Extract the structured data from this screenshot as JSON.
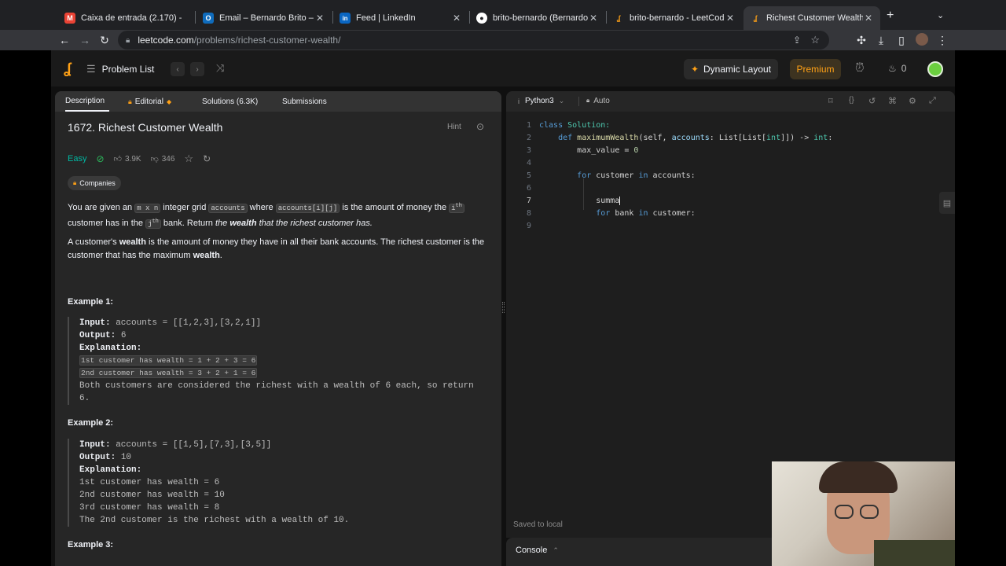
{
  "browser": {
    "tabs": [
      {
        "title": "Caixa de entrada (2.170) - ",
        "icon": "gmail-icon",
        "color": "#ea4335",
        "glyph": "M"
      },
      {
        "title": "Email – Bernardo Brito – Ou",
        "icon": "outlook-icon",
        "color": "#0f6cbd",
        "glyph": "O"
      },
      {
        "title": "Feed | LinkedIn",
        "icon": "linkedin-icon",
        "color": "#0a66c2",
        "glyph": "in"
      },
      {
        "title": "brito-bernardo (Bernardo B",
        "icon": "github-icon",
        "color": "#ffffff",
        "glyph": "●"
      },
      {
        "title": "brito-bernardo - LeetCode",
        "icon": "leetcode-icon",
        "color": "#ffa116",
        "glyph": "L"
      },
      {
        "title": "Richest Customer Wealth -",
        "icon": "leetcode-icon",
        "color": "#ffa116",
        "glyph": "L"
      }
    ],
    "url_host": "leetcode.com",
    "url_path": "/problems/richest-customer-wealth/"
  },
  "header": {
    "problem_list": "Problem List",
    "dynamic_layout": "Dynamic Layout",
    "premium": "Premium",
    "streak": "0"
  },
  "left_tabs": {
    "description": "Description",
    "editorial": "Editorial",
    "solutions": "Solutions (6.3K)",
    "submissions": "Submissions"
  },
  "problem": {
    "title": "1672. Richest Customer Wealth",
    "hint": "Hint",
    "difficulty": "Easy",
    "likes": "3.9K",
    "dislikes": "346",
    "companies": "Companies",
    "p1_a": "You are given an ",
    "p1_code1": "m x n",
    "p1_b": " integer grid ",
    "p1_code2": "accounts",
    "p1_c": " where ",
    "p1_code3": "accounts[i][j]",
    "p1_d": " is the amount of money the ",
    "p1_i": "i",
    "p1_th": "th",
    "p1_e": "customer has in the ",
    "p1_j": "j",
    "p1_f": " bank. Return ",
    "p1_g": "the ",
    "p1_h": "wealth",
    "p1_k": " that the richest customer has.",
    "p2_a": "A customer's ",
    "p2_b": "wealth",
    "p2_c": " is the amount of money they have in all their bank accounts. The richest customer is the customer that has the maximum ",
    "p2_d": "wealth",
    "p2_e": "."
  },
  "examples": {
    "ex1_title": "Example 1:",
    "ex1_input_label": "Input:",
    "ex1_input": " accounts = [[1,2,3],[3,2,1]]",
    "ex1_output_label": "Output:",
    "ex1_output": " 6",
    "ex1_expl_label": "Explanation:",
    "ex1_l1": "1st customer has wealth = 1 + 2 + 3 = 6",
    "ex1_l2": "2nd customer has wealth = 3 + 2 + 1 = 6",
    "ex1_l3": "Both customers are considered the richest with a wealth of 6 each, so return",
    "ex1_l4": "6.",
    "ex2_title": "Example 2:",
    "ex2_input_label": "Input:",
    "ex2_input": " accounts = [[1,5],[7,3],[3,5]]",
    "ex2_output_label": "Output:",
    "ex2_output": " 10",
    "ex2_expl_label": "Explanation:",
    "ex2_l1": "1st customer has wealth = 6",
    "ex2_l2": "2nd customer has wealth = 10",
    "ex2_l3": "3rd customer has wealth = 8",
    "ex2_l4": "The 2nd customer is the richest with a wealth of 10.",
    "ex3_title": "Example 3:"
  },
  "editor": {
    "language": "Python3",
    "mode": "Auto",
    "saved": "Saved to local",
    "console": "Console",
    "line_numbers": [
      "1",
      "2",
      "3",
      "4",
      "5",
      "6",
      "7",
      "8",
      "9"
    ],
    "code": {
      "l1_kw": "class",
      "l1_name": " Solution:",
      "l2_kw": "def",
      "l2_fn": " maximumWealth",
      "l2_a": "(self, ",
      "l2_b": "accounts",
      "l2_c": ": List[List[",
      "l2_d": "int",
      "l2_e": "]]) -> ",
      "l2_f": "int",
      "l2_g": ":",
      "l3_a": "max_value = ",
      "l3_b": "0",
      "l5_kw1": "for",
      "l5_a": " customer ",
      "l5_kw2": "in",
      "l5_b": " accounts:",
      "l7": "summa",
      "l8_kw1": "for",
      "l8_a": " bank ",
      "l8_kw2": "in",
      "l8_b": " customer:"
    }
  },
  "colors": {
    "accent": "#ffa116",
    "easy": "#00b8a3"
  }
}
